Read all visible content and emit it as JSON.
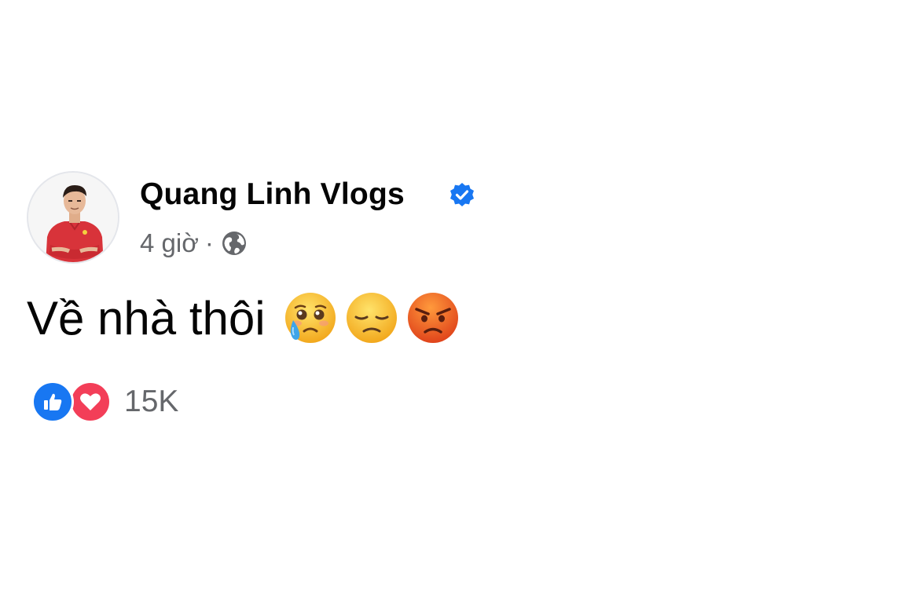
{
  "post": {
    "author_name": "Quang Linh Vlogs",
    "verified_icon": "verified-badge-icon",
    "timestamp": "4 giờ",
    "separator": "·",
    "audience_icon": "globe-icon",
    "text": "Về nhà thôi",
    "emojis": [
      "pleading-face-with-tear",
      "pensive-face",
      "angry-face"
    ],
    "reactions": {
      "icons": [
        "like-icon",
        "love-icon"
      ],
      "count": "15K"
    }
  },
  "colors": {
    "verified_blue": "#1877f2",
    "like_blue": "#1877f2",
    "love_red": "#f33e58",
    "meta_gray": "#65676b",
    "text_dark": "#050505"
  }
}
